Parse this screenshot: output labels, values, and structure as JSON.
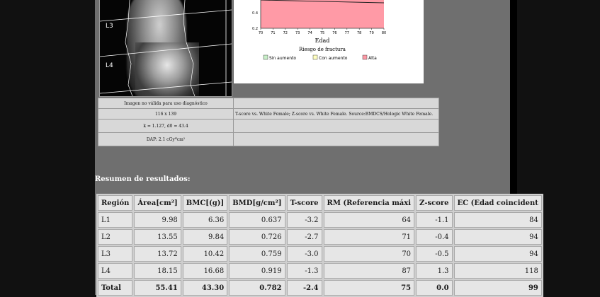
{
  "scan": {
    "labels": [
      "L3",
      "L4"
    ]
  },
  "chart": {
    "y_ticks": [
      "0.4",
      "0.2"
    ],
    "x_ticks": [
      "70",
      "71",
      "72",
      "73",
      "74",
      "75",
      "76",
      "77",
      "78",
      "79",
      "80"
    ],
    "xlabel": "Edad",
    "risk_title": "Riesgo de fractura",
    "legend": [
      {
        "label": "Sin aumento",
        "color": "#c8f0c8"
      },
      {
        "label": "Con aumento",
        "color": "#ffffc0"
      },
      {
        "label": "Alta",
        "color": "#ff9aa6"
      }
    ],
    "fill_color": "#ff9aa6"
  },
  "info": {
    "row1_left": "Imagen no válida para uso diagnóstico",
    "row2_left": "116 x 139",
    "row2_right": "T-score vs. White Female; Z-score vs. White Female. Source:BMDCS/Hologic White Female.",
    "row3_left": "k = 1.127, d0 = 43.4",
    "row4_left": "DAP: 2.1 cGy*cm²"
  },
  "summary_title": "Resumen de resultados:",
  "results": {
    "headers": [
      "Región",
      "Área[cm²]",
      "BMC[(g)]",
      "BMD[g/cm²]",
      "T-score",
      "RM (Referencia máxi",
      "Z-score",
      "EC (Edad coincident"
    ],
    "rows": [
      [
        "L1",
        "9.98",
        "6.36",
        "0.637",
        "-3.2",
        "64",
        "-1.1",
        "84"
      ],
      [
        "L2",
        "13.55",
        "9.84",
        "0.726",
        "-2.7",
        "71",
        "-0.4",
        "94"
      ],
      [
        "L3",
        "13.72",
        "10.42",
        "0.759",
        "-3.0",
        "70",
        "-0.5",
        "94"
      ],
      [
        "L4",
        "18.15",
        "16.68",
        "0.919",
        "-1.3",
        "87",
        "1.3",
        "118"
      ],
      [
        "Total",
        "55.41",
        "43.30",
        "0.782",
        "-2.4",
        "75",
        "0.0",
        "99"
      ]
    ]
  }
}
